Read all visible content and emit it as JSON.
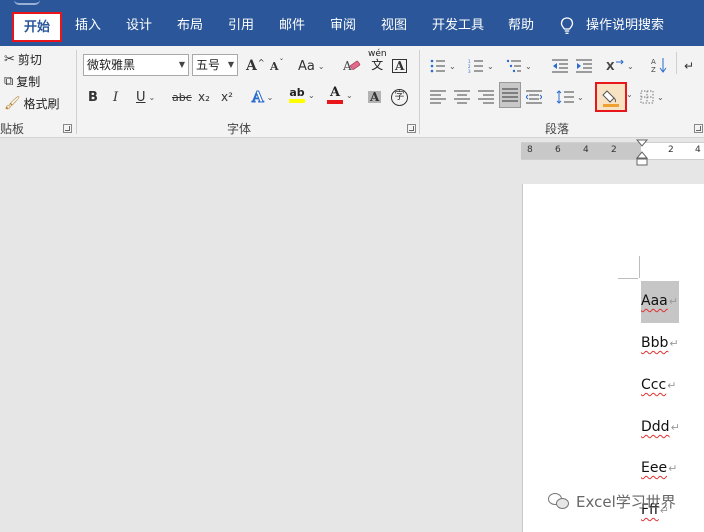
{
  "tabs": {
    "home": "开始",
    "insert": "插入",
    "design": "设计",
    "layout": "布局",
    "references": "引用",
    "mailings": "邮件",
    "review": "审阅",
    "view": "视图",
    "developer": "开发工具",
    "help": "帮助",
    "tell_me": "操作说明搜索"
  },
  "clipboard": {
    "cut": "剪切",
    "copy": "复制",
    "format_painter": "格式刷",
    "group_label": "贴板"
  },
  "font": {
    "font_name": "微软雅黑",
    "font_size": "五号",
    "grow": "A",
    "shrink": "A",
    "change_case": "Aa",
    "phonetic_top": "wén",
    "phonetic_bottom": "文",
    "char_border": "A",
    "bold": "B",
    "italic": "I",
    "underline": "U",
    "strikethrough": "abc",
    "subscript": "x₂",
    "superscript": "x²",
    "text_effects": "A",
    "highlight": "ab",
    "font_color": "A",
    "char_shading": "A",
    "enclose": "字",
    "group_label": "字体"
  },
  "paragraph": {
    "group_label": "段落"
  },
  "ruler": {
    "numbers": [
      "8",
      "6",
      "4",
      "2",
      "2",
      "4"
    ]
  },
  "document": {
    "lines": [
      "Aaa",
      "Bbb",
      "Ccc",
      "Ddd",
      "Eee",
      "Fff"
    ],
    "paragraph_mark": "↵"
  },
  "watermark": "Excel学习世界",
  "colors": {
    "tab_bar": "#2b579a",
    "highlight_red": "#e8161b",
    "highlight_yellow": "#ffff00",
    "font_color_red": "#e8161b"
  }
}
